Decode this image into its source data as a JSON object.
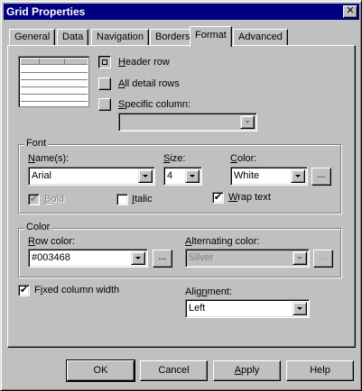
{
  "window": {
    "title": "Grid Properties",
    "close_glyph": "✕"
  },
  "tabs": [
    {
      "label": "General"
    },
    {
      "label": "Data"
    },
    {
      "label": "Navigation"
    },
    {
      "label": "Borders"
    },
    {
      "label": "Format",
      "active": true
    },
    {
      "label": "Advanced"
    }
  ],
  "apply_to": {
    "header_row": {
      "label": "Header row",
      "selected": true
    },
    "all_detail_rows": {
      "label": "All detail rows",
      "selected": false
    },
    "specific_column": {
      "label": "Specific column:",
      "selected": false,
      "value": ""
    }
  },
  "font": {
    "group_label": "Font",
    "name_label": "Name(s):",
    "name_value": "Arial",
    "size_label": "Size:",
    "size_value": "4",
    "color_label": "Color:",
    "color_value": "White",
    "ellipsis": "...",
    "bold": {
      "label": "Bold",
      "checked": true,
      "disabled": true
    },
    "italic": {
      "label": "Italic",
      "checked": false
    },
    "wrap_text": {
      "label": "Wrap text",
      "checked": true
    }
  },
  "color": {
    "group_label": "Color",
    "row_color_label": "Row color:",
    "row_color_value": "#003468",
    "alternating_label": "Alternating color:",
    "alternating_value": "Silver",
    "ellipsis": "..."
  },
  "fixed_column_width": {
    "label": "Fixed column width",
    "checked": true
  },
  "alignment": {
    "label": "Alignment:",
    "value": "Left"
  },
  "buttons": {
    "ok": "OK",
    "cancel": "Cancel",
    "apply": "Apply",
    "help": "Help"
  },
  "colors": {
    "titlebar": "#000080",
    "face": "#c0c0c0"
  }
}
